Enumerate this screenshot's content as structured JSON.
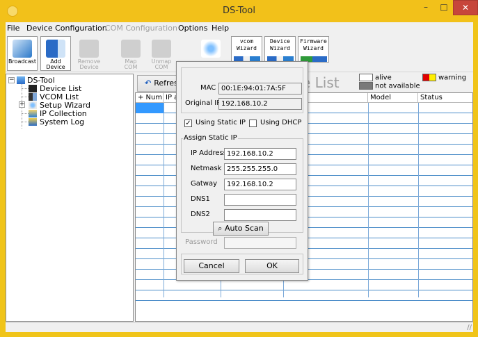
{
  "window": {
    "title": "DS-Tool",
    "min_glyph": "–",
    "max_glyph": "□",
    "close_glyph": "✕"
  },
  "menu": {
    "file": "File",
    "device_configuration": "Device Configuration",
    "com_configuration": "COM Configuration",
    "options": "Options",
    "help": "Help"
  },
  "toolbar": {
    "broadcast": "Broadcast",
    "add_device_1": "Add",
    "add_device_2": "Device",
    "remove_device_1": "Remove",
    "remove_device_2": "Device",
    "map_com": "Map COM",
    "unmap_com_1": "Unmap",
    "unmap_com_2": "COM",
    "vcom_wizard_1": "vcom",
    "vcom_wizard_2": "Wizard",
    "device_wizard_1": "Device",
    "device_wizard_2": "Wizard",
    "firmware_wizard_1": "Firmware",
    "firmware_wizard_2": "Wizard"
  },
  "tree": {
    "root": "DS-Tool",
    "expander_root": "−",
    "expander_setup": "+",
    "items": [
      "Device List",
      "VCOM List",
      "Setup Wizard",
      "IP Collection",
      "System Log"
    ]
  },
  "device_list": {
    "refresh_icon": "↶",
    "refresh_label": "Refres",
    "title_partial": "e List",
    "legend": {
      "alive": "alive",
      "warning": "warning",
      "not_available": "not available",
      "alive_color": "#ffffff",
      "warning_color_left": "#e00000",
      "warning_color_right": "#ffee00",
      "not_available_color": "#7a7a7a"
    },
    "columns": [
      "+ Numbe",
      "IP a",
      "",
      "",
      "Model",
      "Status"
    ]
  },
  "dialog": {
    "mac_label": "MAC",
    "mac_value": "00:1E:94:01:7A:5F",
    "original_ip_label": "Original IP",
    "original_ip_value": "192.168.10.2",
    "using_static_ip": "Using Static IP",
    "using_static_ip_checked": "✓",
    "using_dhcp": "Using DHCP",
    "group_title": "Assign Static IP",
    "ip_address_label": "IP Address",
    "ip_address_value": "192.168.10.2",
    "netmask_label": "Netmask",
    "netmask_value": "255.255.255.0",
    "gateway_label": "Gatway",
    "gateway_value": "192.168.10.2",
    "dns1_label": "DNS1",
    "dns1_value": "",
    "dns2_label": "DNS2",
    "dns2_value": "",
    "auto_scan_label": "Auto Scan",
    "password_label": "Password",
    "password_value": "",
    "cancel_label": "Cancel",
    "ok_label": "OK"
  },
  "status_bar": {
    "grip": "//"
  }
}
